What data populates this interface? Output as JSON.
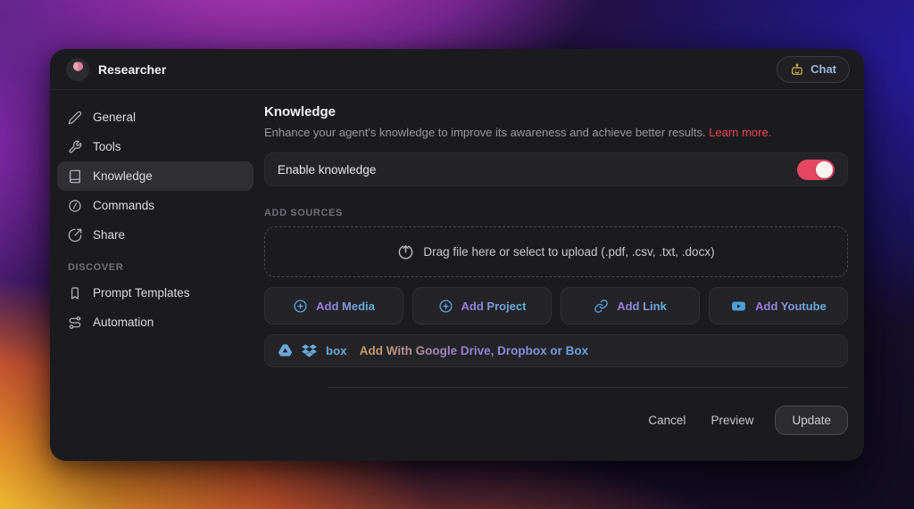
{
  "header": {
    "title": "Researcher",
    "chat_label": "Chat"
  },
  "sidebar": {
    "items": [
      {
        "label": "General"
      },
      {
        "label": "Tools"
      },
      {
        "label": "Knowledge"
      },
      {
        "label": "Commands"
      },
      {
        "label": "Share"
      }
    ],
    "discover_label": "DISCOVER",
    "discover_items": [
      {
        "label": "Prompt Templates"
      },
      {
        "label": "Automation"
      }
    ]
  },
  "main": {
    "title": "Knowledge",
    "description": "Enhance your agent's knowledge to improve its awareness and achieve better results. ",
    "learn_more_label": "Learn more.",
    "enable_label": "Enable knowledge",
    "enable_state": "on",
    "add_sources_label": "ADD SOURCES",
    "dropzone_label": "Drag file here or select to upload (.pdf, .csv, .txt, .docx)",
    "source_buttons": [
      {
        "label": "Add Media"
      },
      {
        "label": "Add Project"
      },
      {
        "label": "Add Link"
      },
      {
        "label": "Add Youtube"
      }
    ],
    "cloud_label": "Add With Google Drive, Dropbox or Box",
    "box_logo_text": "box"
  },
  "footer": {
    "cancel_label": "Cancel",
    "preview_label": "Preview",
    "update_label": "Update"
  },
  "colors": {
    "toggle_on": "#e54762",
    "learn_more_red": "#e5484d",
    "icon_blue": "#5aa9de",
    "gradient_text_start": "#a478dd",
    "gradient_text_end": "#5fb8dc"
  }
}
